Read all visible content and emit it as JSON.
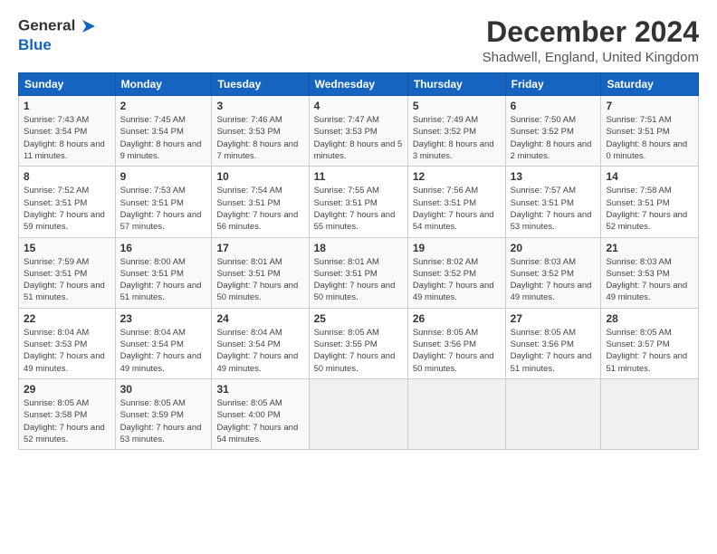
{
  "logo": {
    "line1": "General",
    "line2": "Blue"
  },
  "title": "December 2024",
  "subtitle": "Shadwell, England, United Kingdom",
  "calendar": {
    "headers": [
      "Sunday",
      "Monday",
      "Tuesday",
      "Wednesday",
      "Thursday",
      "Friday",
      "Saturday"
    ],
    "weeks": [
      [
        {
          "day": "",
          "info": ""
        },
        {
          "day": "2",
          "info": "Sunrise: 7:45 AM\nSunset: 3:54 PM\nDaylight: 8 hours and 9 minutes."
        },
        {
          "day": "3",
          "info": "Sunrise: 7:46 AM\nSunset: 3:53 PM\nDaylight: 8 hours and 7 minutes."
        },
        {
          "day": "4",
          "info": "Sunrise: 7:47 AM\nSunset: 3:53 PM\nDaylight: 8 hours and 5 minutes."
        },
        {
          "day": "5",
          "info": "Sunrise: 7:49 AM\nSunset: 3:52 PM\nDaylight: 8 hours and 3 minutes."
        },
        {
          "day": "6",
          "info": "Sunrise: 7:50 AM\nSunset: 3:52 PM\nDaylight: 8 hours and 2 minutes."
        },
        {
          "day": "7",
          "info": "Sunrise: 7:51 AM\nSunset: 3:51 PM\nDaylight: 8 hours and 0 minutes."
        }
      ],
      [
        {
          "day": "1",
          "info": "Sunrise: 7:43 AM\nSunset: 3:54 PM\nDaylight: 8 hours and 11 minutes."
        },
        {
          "day": "",
          "info": ""
        },
        {
          "day": "",
          "info": ""
        },
        {
          "day": "",
          "info": ""
        },
        {
          "day": "",
          "info": ""
        },
        {
          "day": "",
          "info": ""
        },
        {
          "day": "",
          "info": ""
        }
      ],
      [
        {
          "day": "8",
          "info": "Sunrise: 7:52 AM\nSunset: 3:51 PM\nDaylight: 7 hours and 59 minutes."
        },
        {
          "day": "9",
          "info": "Sunrise: 7:53 AM\nSunset: 3:51 PM\nDaylight: 7 hours and 57 minutes."
        },
        {
          "day": "10",
          "info": "Sunrise: 7:54 AM\nSunset: 3:51 PM\nDaylight: 7 hours and 56 minutes."
        },
        {
          "day": "11",
          "info": "Sunrise: 7:55 AM\nSunset: 3:51 PM\nDaylight: 7 hours and 55 minutes."
        },
        {
          "day": "12",
          "info": "Sunrise: 7:56 AM\nSunset: 3:51 PM\nDaylight: 7 hours and 54 minutes."
        },
        {
          "day": "13",
          "info": "Sunrise: 7:57 AM\nSunset: 3:51 PM\nDaylight: 7 hours and 53 minutes."
        },
        {
          "day": "14",
          "info": "Sunrise: 7:58 AM\nSunset: 3:51 PM\nDaylight: 7 hours and 52 minutes."
        }
      ],
      [
        {
          "day": "15",
          "info": "Sunrise: 7:59 AM\nSunset: 3:51 PM\nDaylight: 7 hours and 51 minutes."
        },
        {
          "day": "16",
          "info": "Sunrise: 8:00 AM\nSunset: 3:51 PM\nDaylight: 7 hours and 51 minutes."
        },
        {
          "day": "17",
          "info": "Sunrise: 8:01 AM\nSunset: 3:51 PM\nDaylight: 7 hours and 50 minutes."
        },
        {
          "day": "18",
          "info": "Sunrise: 8:01 AM\nSunset: 3:51 PM\nDaylight: 7 hours and 50 minutes."
        },
        {
          "day": "19",
          "info": "Sunrise: 8:02 AM\nSunset: 3:52 PM\nDaylight: 7 hours and 49 minutes."
        },
        {
          "day": "20",
          "info": "Sunrise: 8:03 AM\nSunset: 3:52 PM\nDaylight: 7 hours and 49 minutes."
        },
        {
          "day": "21",
          "info": "Sunrise: 8:03 AM\nSunset: 3:53 PM\nDaylight: 7 hours and 49 minutes."
        }
      ],
      [
        {
          "day": "22",
          "info": "Sunrise: 8:04 AM\nSunset: 3:53 PM\nDaylight: 7 hours and 49 minutes."
        },
        {
          "day": "23",
          "info": "Sunrise: 8:04 AM\nSunset: 3:54 PM\nDaylight: 7 hours and 49 minutes."
        },
        {
          "day": "24",
          "info": "Sunrise: 8:04 AM\nSunset: 3:54 PM\nDaylight: 7 hours and 49 minutes."
        },
        {
          "day": "25",
          "info": "Sunrise: 8:05 AM\nSunset: 3:55 PM\nDaylight: 7 hours and 50 minutes."
        },
        {
          "day": "26",
          "info": "Sunrise: 8:05 AM\nSunset: 3:56 PM\nDaylight: 7 hours and 50 minutes."
        },
        {
          "day": "27",
          "info": "Sunrise: 8:05 AM\nSunset: 3:56 PM\nDaylight: 7 hours and 51 minutes."
        },
        {
          "day": "28",
          "info": "Sunrise: 8:05 AM\nSunset: 3:57 PM\nDaylight: 7 hours and 51 minutes."
        }
      ],
      [
        {
          "day": "29",
          "info": "Sunrise: 8:05 AM\nSunset: 3:58 PM\nDaylight: 7 hours and 52 minutes."
        },
        {
          "day": "30",
          "info": "Sunrise: 8:05 AM\nSunset: 3:59 PM\nDaylight: 7 hours and 53 minutes."
        },
        {
          "day": "31",
          "info": "Sunrise: 8:05 AM\nSunset: 4:00 PM\nDaylight: 7 hours and 54 minutes."
        },
        {
          "day": "",
          "info": ""
        },
        {
          "day": "",
          "info": ""
        },
        {
          "day": "",
          "info": ""
        },
        {
          "day": "",
          "info": ""
        }
      ]
    ]
  }
}
